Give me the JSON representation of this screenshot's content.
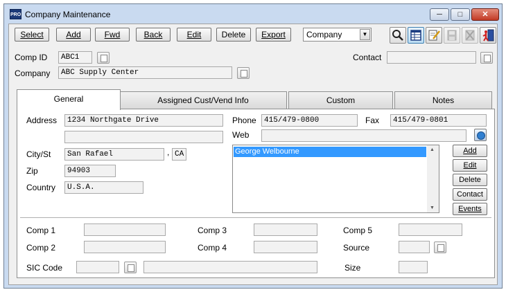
{
  "window": {
    "app_icon_text": "PRO",
    "title": "Company Maintenance"
  },
  "toolbar": {
    "select": "Select",
    "add": "Add",
    "fwd": "Fwd",
    "back": "Back",
    "edit": "Edit",
    "delete": "Delete",
    "export": "Export",
    "view_combo_value": "Company",
    "icons": [
      "search-icon",
      "grid-view-icon",
      "notes-icon",
      "save-icon",
      "cancel-icon",
      "exit-icon"
    ]
  },
  "header": {
    "comp_id_label": "Comp ID",
    "comp_id_value": "ABC1",
    "company_label": "Company",
    "company_value": "ABC Supply Center",
    "contact_label": "Contact",
    "contact_value": ""
  },
  "tabs": [
    {
      "label": "General",
      "selected": true
    },
    {
      "label": "Assigned Cust/Vend Info",
      "selected": false
    },
    {
      "label": "Custom",
      "selected": false
    },
    {
      "label": "Notes",
      "selected": false
    }
  ],
  "general": {
    "address_label": "Address",
    "address_line1": "1234 Northgate Drive",
    "address_line2": "",
    "city_st_label": "City/St",
    "city": "San Rafael",
    "state": "CA",
    "state_separator": ",",
    "zip_label": "Zip",
    "zip": "94903",
    "country_label": "Country",
    "country": "U.S.A.",
    "phone_label": "Phone",
    "phone": "415/479-0800",
    "fax_label": "Fax",
    "fax": "415/479-0801",
    "web_label": "Web",
    "web": "",
    "contacts": [
      "George Welbourne"
    ],
    "contact_buttons": {
      "add": "Add",
      "edit": "Edit",
      "delete": "Delete",
      "contact": "Contact",
      "events": "Events"
    },
    "comp1_label": "Comp 1",
    "comp2_label": "Comp 2",
    "comp3_label": "Comp 3",
    "comp4_label": "Comp 4",
    "comp5_label": "Comp 5",
    "source_label": "Source",
    "sic_code_label": "SIC Code",
    "size_label": "Size"
  }
}
